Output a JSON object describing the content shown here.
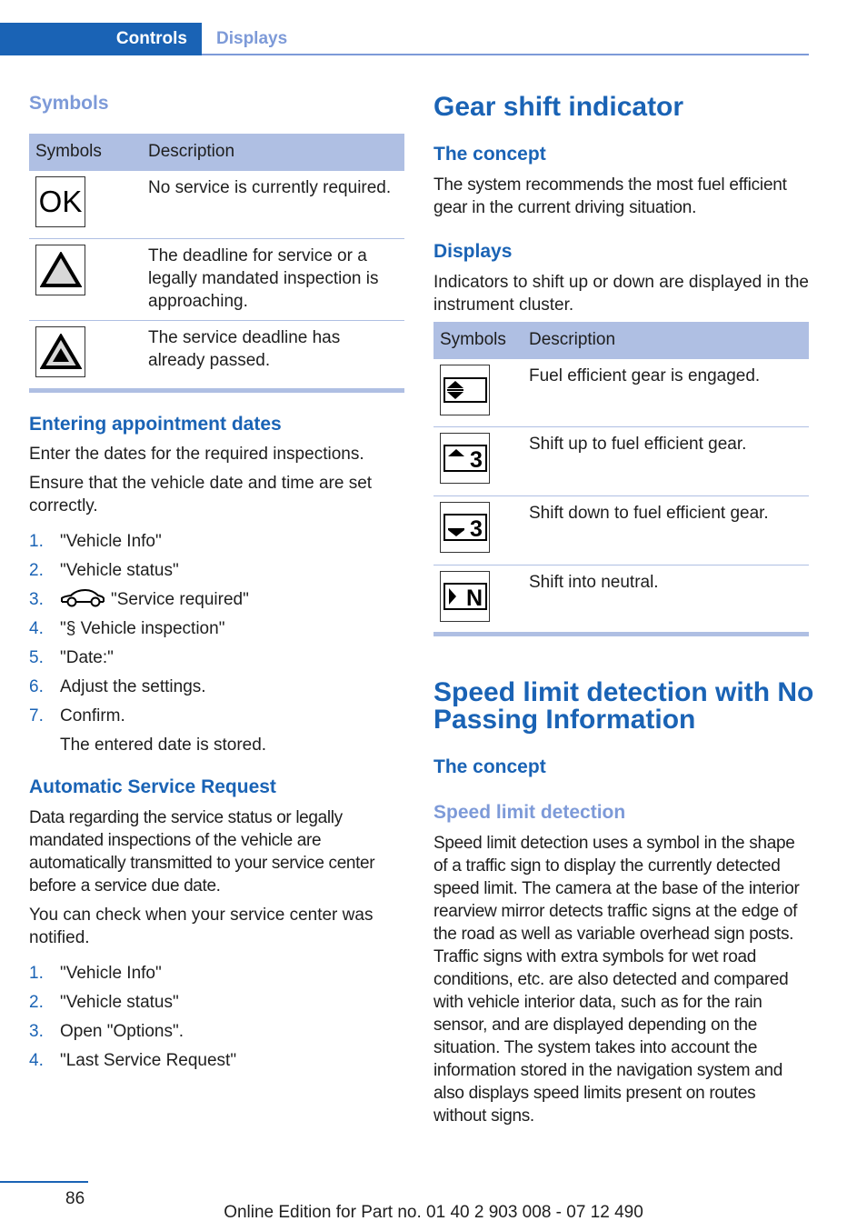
{
  "header": {
    "active_tab": "Controls",
    "inactive_tab": "Displays"
  },
  "left": {
    "symbols_heading": "Symbols",
    "service_table": {
      "headers": [
        "Symbols",
        "Description"
      ],
      "rows": [
        {
          "icon": "ok-icon",
          "icon_text": "OK",
          "description": "No service is currently required."
        },
        {
          "icon": "warning-triangle-icon",
          "description": "The deadline for service or a legally mandated inspection is approaching."
        },
        {
          "icon": "warning-triangle-filled-icon",
          "description": "The service deadline has already passed."
        }
      ]
    },
    "appointment": {
      "heading": "Entering appointment dates",
      "para1": "Enter the dates for the required inspections.",
      "para2": "Ensure that the vehicle date and time are set correctly.",
      "steps": [
        {
          "num": "1.",
          "text": "\"Vehicle Info\""
        },
        {
          "num": "2.",
          "text": "\"Vehicle status\""
        },
        {
          "num": "3.",
          "icon": "car-icon",
          "text": "\"Service required\""
        },
        {
          "num": "4.",
          "text": "\"§ Vehicle inspection\""
        },
        {
          "num": "5.",
          "text": "\"Date:\""
        },
        {
          "num": "6.",
          "text": "Adjust the settings."
        },
        {
          "num": "7.",
          "text": "Confirm."
        }
      ],
      "step7_result": "The entered date is stored."
    },
    "auto_service": {
      "heading": "Automatic Service Request",
      "para1": "Data regarding the service status or legally mandated inspections of the vehicle are automatically transmitted to your service center before a service due date.",
      "para2": "You can check when your service center was notified.",
      "steps": [
        {
          "num": "1.",
          "text": "\"Vehicle Info\""
        },
        {
          "num": "2.",
          "text": "\"Vehicle status\""
        },
        {
          "num": "3.",
          "text": "Open \"Options\"."
        },
        {
          "num": "4.",
          "text": "\"Last Service Request\""
        }
      ]
    }
  },
  "right": {
    "gear": {
      "title": "Gear shift indicator",
      "concept_heading": "The concept",
      "concept_text": "The system recommends the most fuel efficient gear in the current driving situation.",
      "displays_heading": "Displays",
      "displays_text": "Indicators to shift up or down are displayed in the instrument cluster.",
      "table": {
        "headers": [
          "Symbols",
          "Description"
        ],
        "rows": [
          {
            "icon": "gear-engaged-icon",
            "description": "Fuel efficient gear is engaged."
          },
          {
            "icon": "shift-up-icon",
            "icon_text": "3",
            "description": "Shift up to fuel efficient gear."
          },
          {
            "icon": "shift-down-icon",
            "icon_text": "3",
            "description": "Shift down to fuel efficient gear."
          },
          {
            "icon": "shift-neutral-icon",
            "icon_text": "N",
            "description": "Shift into neutral."
          }
        ]
      }
    },
    "speed": {
      "title": "Speed limit detection with No Passing Information",
      "concept_heading": "The concept",
      "sub_heading": "Speed limit detection",
      "text": "Speed limit detection uses a symbol in the shape of a traffic sign to display the currently detected speed limit. The camera at the base of the interior rearview mirror detects traffic signs at the edge of the road as well as variable overhead sign posts. Traffic signs with extra symbols for wet road conditions, etc. are also detected and compared with vehicle interior data, such as for the rain sensor, and are displayed depending on the situation. The system takes into account the information stored in the navigation system and also displays speed limits present on routes without signs."
    }
  },
  "footer": {
    "page_number": "86",
    "edition": "Online Edition for Part no. 01 40 2 903 008 - 07 12 490"
  }
}
